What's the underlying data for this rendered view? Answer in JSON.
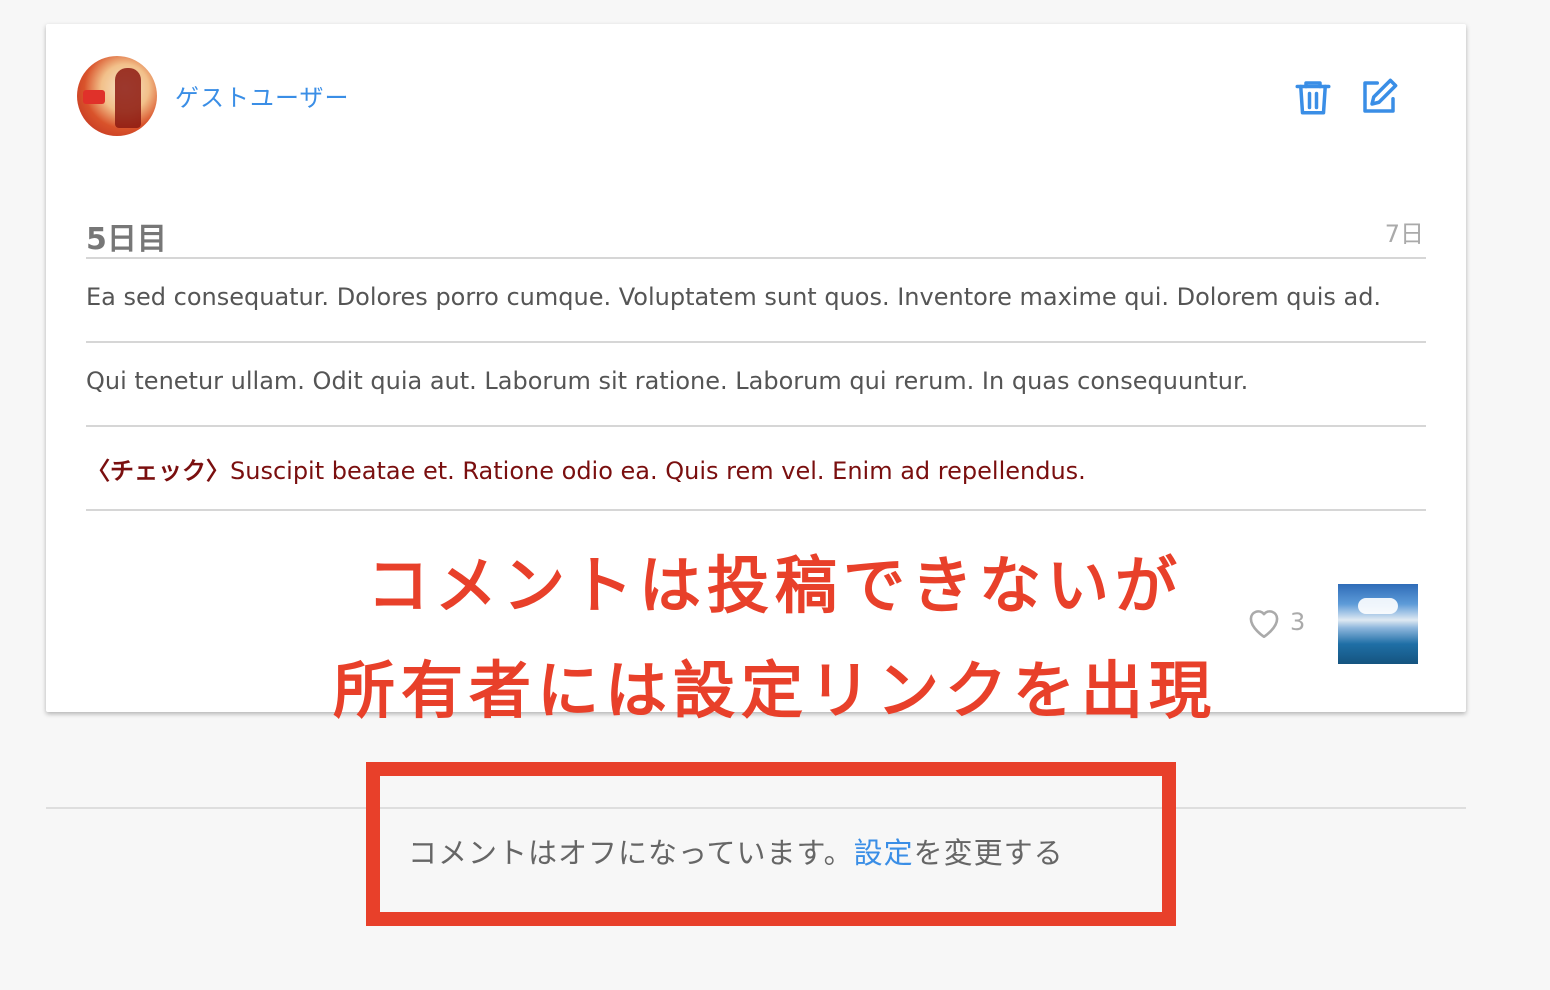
{
  "user": {
    "name": "ゲストユーザー"
  },
  "actions": {
    "delete_icon": "trash-icon",
    "edit_icon": "edit-icon"
  },
  "entry": {
    "title": "5日目",
    "count_label": "7日",
    "lines": [
      "Ea sed consequatur. Dolores porro cumque. Voluptatem sunt quos. Inventore maxime qui. Dolorem quis ad.",
      "Qui tenetur ullam. Odit quia aut. Laborum sit ratione. Laborum qui rerum. In quas consequuntur."
    ],
    "check_prefix": "〈チェック〉",
    "check_text": "Suscipit beatae et. Ratione odio ea. Quis rem vel. Enim ad repellendus."
  },
  "likes": {
    "count": "3",
    "icon": "heart-icon"
  },
  "annotation": {
    "line1": "コメントは投稿できないが",
    "line2": "所有者には設定リンクを出現"
  },
  "comments": {
    "off_text": "コメントはオフになっています。",
    "settings_link": "設定",
    "change_text": "を変更する"
  },
  "colors": {
    "accent": "#3a8ee6",
    "annotation_red": "#e8402a",
    "check_text": "#7a0f0f"
  }
}
